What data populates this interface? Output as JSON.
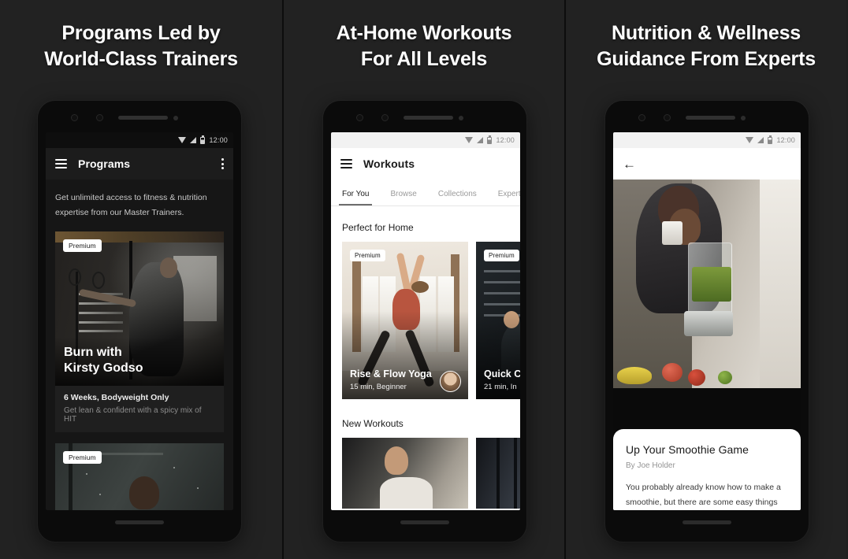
{
  "theme": {
    "background": "#222222",
    "divider": "#0d0d0d",
    "accent_white": "#ffffff"
  },
  "panels": [
    {
      "headline_line1": "Programs Led by",
      "headline_line2": "World-Class Trainers",
      "phone": {
        "statusbar": {
          "time": "12:00",
          "icons": [
            "wifi-icon",
            "signal-icon",
            "battery-icon"
          ]
        },
        "appbar": {
          "menu_icon": "hamburger-menu-icon",
          "title": "Programs",
          "overflow_icon": "kebab-menu-icon"
        },
        "intro": "Get unlimited access to fitness & nutrition expertise from our Master Trainers.",
        "cards": [
          {
            "badge": "Premium",
            "title_line1": "Burn with",
            "title_line2": "Kirsty Godso",
            "footer_title": "6 Weeks, Bodyweight Only",
            "footer_subtitle": "Get lean & confident with a spicy mix of HIT"
          },
          {
            "badge": "Premium"
          }
        ],
        "navbar": {
          "back": "back-triangle-icon",
          "home": "home-circle-icon",
          "recents": "recents-square-icon"
        }
      }
    },
    {
      "headline_line1": "At-Home Workouts",
      "headline_line2": "For All Levels",
      "phone": {
        "statusbar": {
          "time": "12:00",
          "icons": [
            "wifi-icon",
            "signal-icon",
            "battery-icon"
          ]
        },
        "appbar": {
          "menu_icon": "hamburger-menu-icon",
          "title": "Workouts"
        },
        "tabs": [
          {
            "label": "For You",
            "active": true
          },
          {
            "label": "Browse",
            "active": false
          },
          {
            "label": "Collections",
            "active": false
          },
          {
            "label": "Expert",
            "active": false
          }
        ],
        "sections": [
          {
            "title": "Perfect for Home",
            "tiles": [
              {
                "badge": "Premium",
                "title": "Rise & Flow Yoga",
                "subtitle": "15 min, Beginner",
                "avatar": "trainer-avatar"
              },
              {
                "badge": "Premium",
                "title": "Quick C",
                "subtitle": "21 min, In"
              }
            ]
          },
          {
            "title": "New Workouts",
            "tiles": [
              {},
              {}
            ]
          }
        ],
        "navbar": {
          "back": "back-triangle-icon",
          "home": "home-circle-icon",
          "recents": "recents-square-icon"
        }
      }
    },
    {
      "headline_line1": "Nutrition & Wellness",
      "headline_line2": "Guidance From Experts",
      "phone": {
        "statusbar": {
          "time": "12:00",
          "icons": [
            "wifi-icon",
            "signal-icon",
            "battery-icon"
          ]
        },
        "appbar": {
          "back_icon": "back-arrow-icon"
        },
        "article": {
          "title": "Up Your Smoothie Game",
          "author": "By Joe Holder",
          "body": "You probably already know how to make a smoothie, but there are some easy things"
        }
      }
    }
  ]
}
